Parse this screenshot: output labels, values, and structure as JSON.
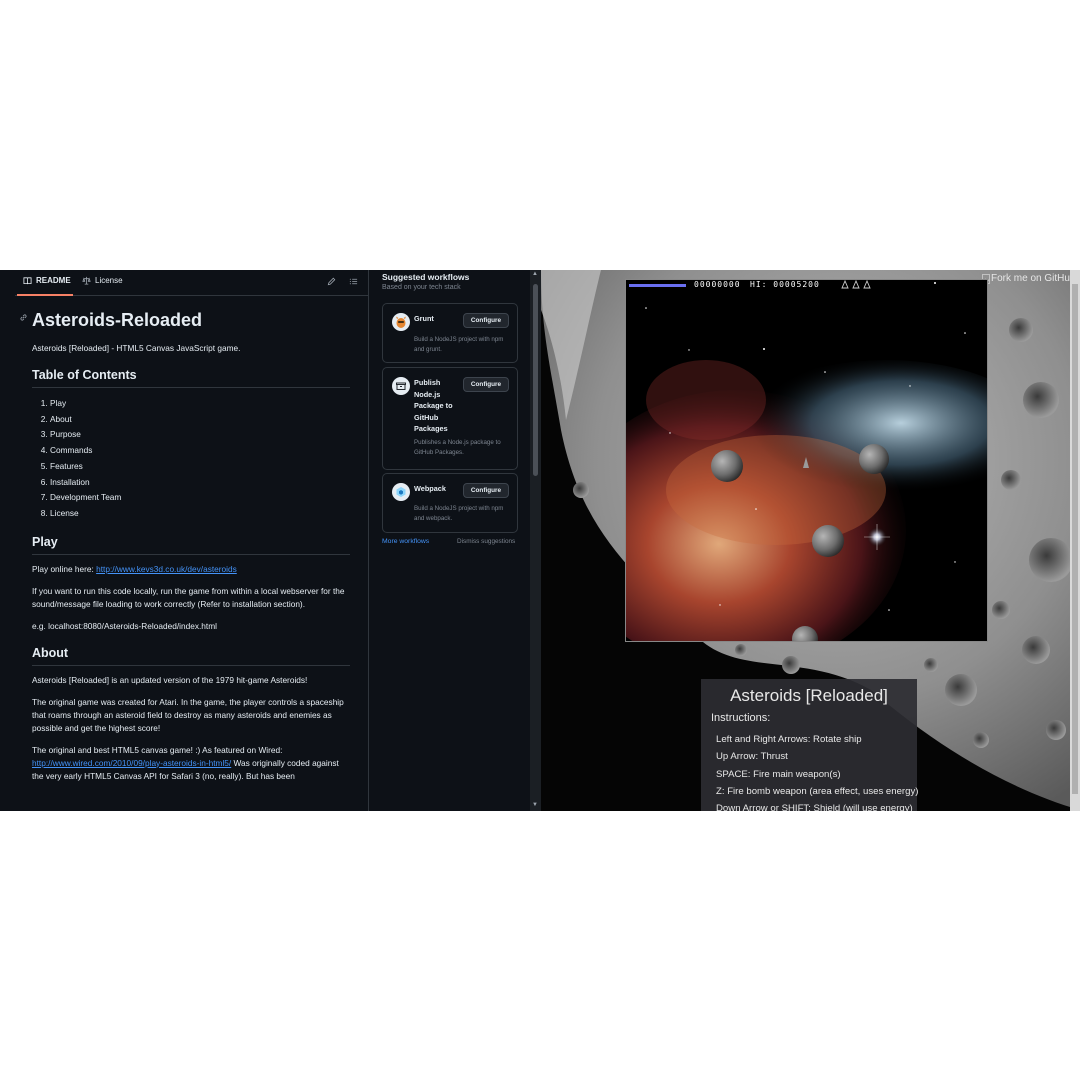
{
  "readme_tabs": {
    "readme": "README",
    "license": "License"
  },
  "readme": {
    "title": "Asteroids-Reloaded",
    "tagline": "Asteroids [Reloaded] - HTML5 Canvas JavaScript game.",
    "toc_heading": "Table of Contents",
    "toc": [
      "Play",
      "About",
      "Purpose",
      "Commands",
      "Features",
      "Installation",
      "Development Team",
      "License"
    ],
    "play_heading": "Play",
    "play_online": "Play online here: ",
    "play_link": "http://www.kevs3d.co.uk/dev/asteroids",
    "play_local": "If you want to run this code locally, run the game from within a local webserver for the sound/message file loading to work correctly (Refer to installation section).",
    "play_eg": "e.g. localhost:8080/Asteroids-Reloaded/index.html",
    "about_heading": "About",
    "about_p1": "Asteroids [Reloaded] is an updated version of the 1979 hit-game Asteroids!",
    "about_p2": "The original game was created for Atari. In the game, the player controls a spaceship that roams through an asteroid field to destroy as many asteroids and enemies as possible and get the highest score!",
    "about_p3_a": "The original and best HTML5 canvas game! :) As featured on Wired: ",
    "about_p3_link": "http://www.wired.com/2010/09/play-asteroids-in-html5/",
    "about_p3_b": " Was originally coded against the very early HTML5 Canvas API for Safari 3 (no, really). But has been"
  },
  "workflows": {
    "title": "Suggested workflows",
    "subtitle": "Based on your tech stack",
    "cards": [
      {
        "name": "Grunt",
        "desc": "Build a NodeJS project with npm and grunt.",
        "button": "Configure"
      },
      {
        "name": "Publish Node.js Package to GitHub Packages",
        "desc": "Publishes a Node.js package to GitHub Packages.",
        "button": "Configure"
      },
      {
        "name": "Webpack",
        "desc": "Build a NodeJS project with npm and webpack.",
        "button": "Configure"
      }
    ],
    "more": "More workflows",
    "dismiss": "Dismiss suggestions"
  },
  "game": {
    "fork_ribbon": "Fork me on GitHub",
    "score": "00000000",
    "hiscore": "HI: 00005200",
    "lives": 3,
    "energy_fraction": 0.95,
    "instructions_title": "Asteroids [Reloaded]",
    "instructions_label": "Instructions:",
    "instructions": [
      "Left and Right Arrows: Rotate ship",
      "Up Arrow: Thrust",
      "SPACE: Fire main weapon(s)",
      "Z: Fire bomb weapon (area effect, uses energy)",
      "Down Arrow or SHIFT: Shield (will use energy)"
    ]
  },
  "colors": {
    "bg": "#0d1117",
    "text": "#e6edf3",
    "muted": "#7d8590",
    "link": "#4493f8",
    "border": "#30363d",
    "tab_underline": "#f78166"
  }
}
